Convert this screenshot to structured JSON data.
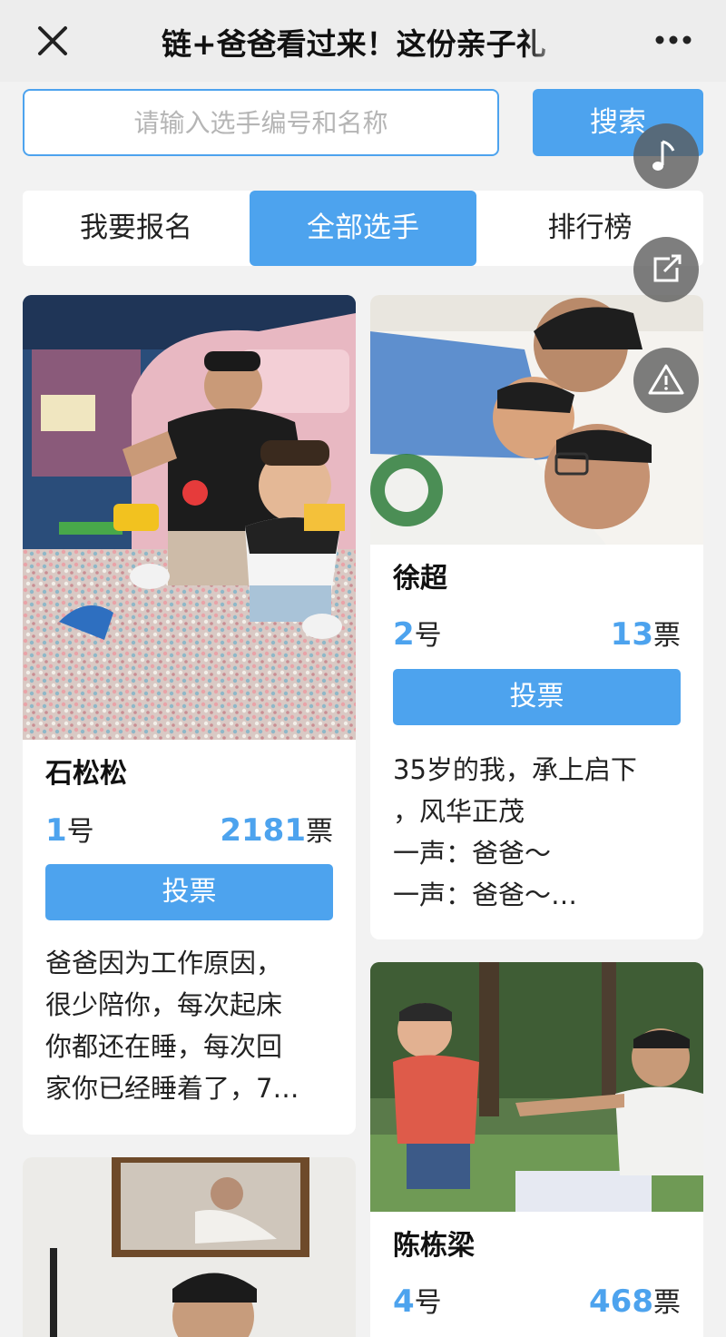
{
  "header": {
    "title": "链+爸爸看过来！这份亲子礼",
    "close_icon": "close-icon",
    "more_icon": "more-icon"
  },
  "search": {
    "placeholder": "请输入选手编号和名称",
    "value": "",
    "button_label": "搜索"
  },
  "tabs": [
    {
      "label": "我要报名",
      "active": false
    },
    {
      "label": "全部选手",
      "active": true
    },
    {
      "label": "排行榜",
      "active": false
    }
  ],
  "floating_buttons": [
    {
      "icon": "music-note-icon"
    },
    {
      "icon": "share-icon"
    },
    {
      "icon": "warning-icon"
    }
  ],
  "contestants": [
    {
      "name": "石松松",
      "number": "1",
      "number_suffix": "号",
      "votes": "2181",
      "votes_suffix": "票",
      "vote_label": "投票",
      "description": [
        "爸爸因为工作原因，",
        "很少陪你，每次起床",
        "你都还在睡，每次回",
        "家你已经睡着了，7…"
      ]
    },
    {
      "name": "徐超",
      "number": "2",
      "number_suffix": "号",
      "votes": "13",
      "votes_suffix": "票",
      "vote_label": "投票",
      "description": [
        "35岁的我，承上启下",
        "，风华正茂",
        "一声：爸爸～",
        "一声：爸爸～…"
      ]
    },
    {
      "name": "陈栋梁",
      "number": "4",
      "number_suffix": "号",
      "votes": "468",
      "votes_suffix": "票"
    }
  ],
  "colors": {
    "accent": "#4da3ee",
    "background": "#f2f2f2",
    "header_bg": "#ededed"
  }
}
